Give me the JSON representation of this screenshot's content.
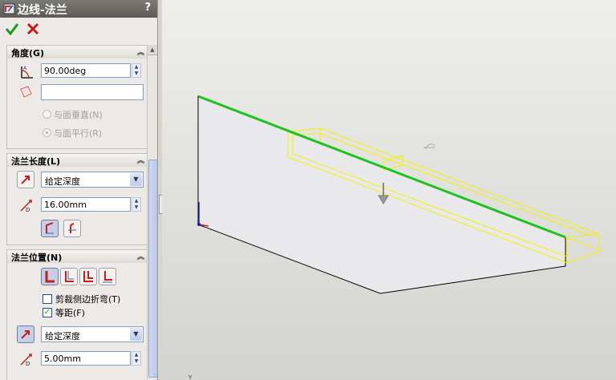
{
  "property_manager": {
    "title": "边线-法兰",
    "help": "?",
    "ok_icon": "checkmark-icon",
    "cancel_icon": "x-icon"
  },
  "angle_group": {
    "title": "角度(G)",
    "angle_value": "90.00deg",
    "reference_value": "",
    "radio_perpendicular": "与面垂直(N)",
    "radio_parallel": "与面平行(R)"
  },
  "length_group": {
    "title": "法兰长度(L)",
    "end_condition": "给定深度",
    "length_value": "16.00mm"
  },
  "position_group": {
    "title": "法兰位置(N)",
    "trim_side_bends": "剪裁侧边折弯(T)",
    "trim_checked": false,
    "offset": "等距(F)",
    "offset_checked": true,
    "offset_end_condition": "给定深度",
    "offset_value": "5.00mm"
  },
  "colors": {
    "edge_highlight": "#1ec21e",
    "preview": "#f5f000",
    "viewport_top": "#eeeeec",
    "viewport_bottom": "#d3d3cf"
  }
}
